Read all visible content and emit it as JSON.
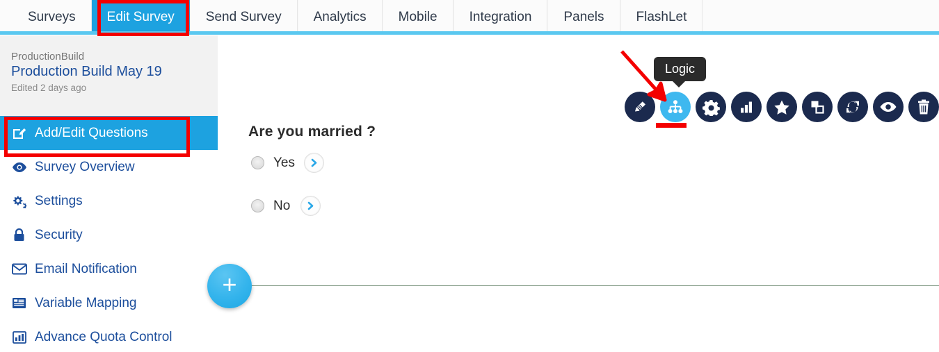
{
  "nav": {
    "tabs": [
      {
        "label": "Surveys",
        "active": false
      },
      {
        "label": "Edit Survey",
        "active": true
      },
      {
        "label": "Send Survey",
        "active": false
      },
      {
        "label": "Analytics",
        "active": false
      },
      {
        "label": "Mobile",
        "active": false
      },
      {
        "label": "Integration",
        "active": false
      },
      {
        "label": "Panels",
        "active": false
      },
      {
        "label": "FlashLet",
        "active": false
      }
    ]
  },
  "sidebar": {
    "header": {
      "project": "ProductionBuild",
      "survey_title": "Production Build May 19",
      "edited": "Edited 2 days ago"
    },
    "items": [
      {
        "label": "Add/Edit Questions",
        "icon": "edit-pencil-square-icon",
        "active": true
      },
      {
        "label": "Survey Overview",
        "icon": "eye-icon",
        "active": false
      },
      {
        "label": "Settings",
        "icon": "gears-icon",
        "active": false
      },
      {
        "label": "Security",
        "icon": "lock-icon",
        "active": false
      },
      {
        "label": "Email Notification",
        "icon": "envelope-icon",
        "active": false
      },
      {
        "label": "Variable Mapping",
        "icon": "list-panel-icon",
        "active": false
      },
      {
        "label": "Advance Quota Control",
        "icon": "bar-chart-icon",
        "active": false
      }
    ]
  },
  "main": {
    "question": {
      "text": "Are you married ?",
      "options": [
        {
          "label": "Yes"
        },
        {
          "label": "No"
        }
      ]
    },
    "add_question_button": "+"
  },
  "toolbar": {
    "tooltip": "Logic",
    "icons": [
      {
        "name": "edit-pencil-icon",
        "selected": false
      },
      {
        "name": "logic-tree-icon",
        "selected": true
      },
      {
        "name": "settings-gear-icon",
        "selected": false
      },
      {
        "name": "bar-chart-icon",
        "selected": false
      },
      {
        "name": "star-icon",
        "selected": false
      },
      {
        "name": "copy-duplicate-icon",
        "selected": false
      },
      {
        "name": "refresh-sync-icon",
        "selected": false
      },
      {
        "name": "preview-eye-icon",
        "selected": false
      },
      {
        "name": "trash-delete-icon",
        "selected": false
      }
    ]
  },
  "colors": {
    "accent_blue": "#1da2e0",
    "nav_underline": "#5ac8f0",
    "annotation_red": "#f40000",
    "sidebar_link": "#1c4e9c",
    "toolbar_dark": "#1b2a4e",
    "toolbar_selected": "#3eb8ef"
  }
}
